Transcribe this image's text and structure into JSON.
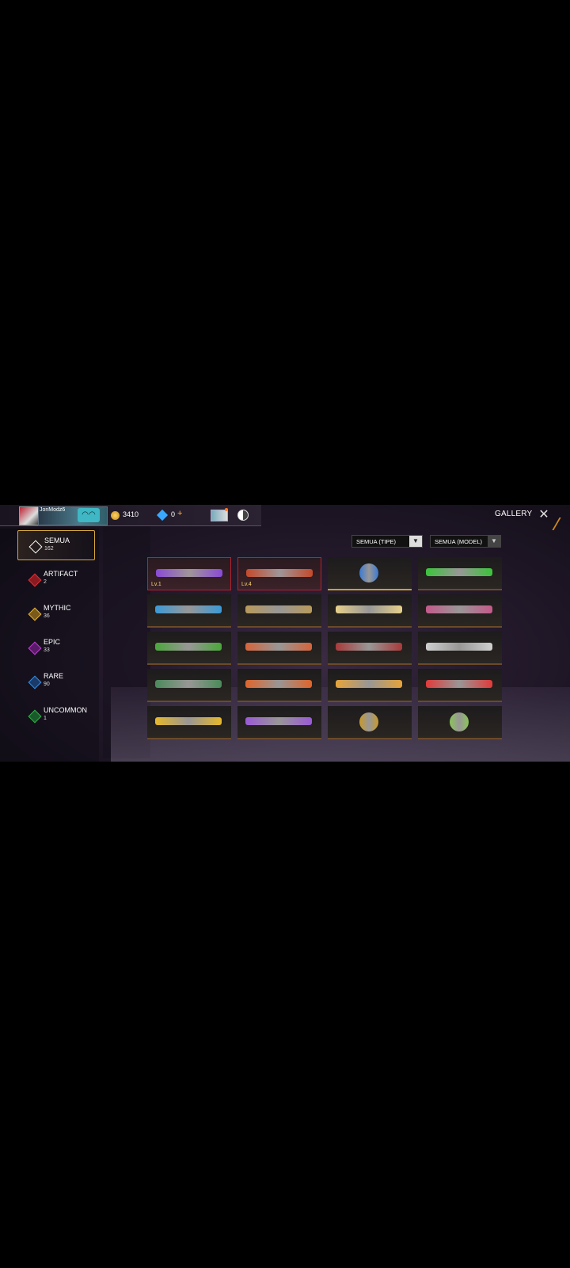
{
  "header": {
    "nickname": "JonModz6",
    "coins": "3410",
    "diamonds": "0",
    "diamond_plus": "+",
    "title": "GALLERY",
    "close": "✕"
  },
  "sidebar": {
    "items": [
      {
        "label": "SEMUA",
        "count": "162",
        "color": "#ffffff",
        "active": true
      },
      {
        "label": "ARTIFACT",
        "count": "2",
        "color": "#e0303a"
      },
      {
        "label": "MYTHIC",
        "count": "36",
        "color": "#e3b43a"
      },
      {
        "label": "EPIC",
        "count": "33",
        "color": "#c23fd6"
      },
      {
        "label": "RARE",
        "count": "90",
        "color": "#3a8fe0"
      },
      {
        "label": "UNCOMMON",
        "count": "1",
        "color": "#32b24a"
      }
    ]
  },
  "filters": {
    "type": "SEMUA (TIPE)",
    "model": "SEMUA (MODEL)",
    "arrow": "▼"
  },
  "grid": {
    "items": [
      {
        "icon": "purple-rifle-icon",
        "level": "Lv.1",
        "color": "#8a4ad6"
      },
      {
        "icon": "dragon-rifle-icon",
        "level": "Lv.4",
        "color": "#c44a2a"
      },
      {
        "icon": "blue-mask-icon",
        "color": "#3a7ad6"
      },
      {
        "icon": "green-rifle-icon",
        "color": "#3ac43a"
      },
      {
        "icon": "blue-rifle-icon",
        "color": "#3a9ad6"
      },
      {
        "icon": "gold-rifle-icon",
        "color": "#b89a5a"
      },
      {
        "icon": "gold-white-rifle-icon",
        "color": "#e6d08a"
      },
      {
        "icon": "pink-smg-icon",
        "color": "#c45a8a"
      },
      {
        "icon": "green-dragon-gun-icon",
        "color": "#4aa63a"
      },
      {
        "icon": "fire-dragon-gun-icon",
        "color": "#d6643a"
      },
      {
        "icon": "red-rifle-icon",
        "color": "#a83a3a"
      },
      {
        "icon": "silver-rifle-icon",
        "color": "#cfcfcf"
      },
      {
        "icon": "green-shotgun-icon",
        "color": "#4a8a5a"
      },
      {
        "icon": "fire-crossbow-icon",
        "color": "#e0642a"
      },
      {
        "icon": "flame-dragon-icon",
        "color": "#e6a33a"
      },
      {
        "icon": "candy-cane-icon",
        "color": "#e03a3a"
      },
      {
        "icon": "yellow-umbrella-icon",
        "color": "#e6b82a"
      },
      {
        "icon": "purple-scythe-icon",
        "color": "#9a5ad6"
      },
      {
        "icon": "gold-grenade-icon",
        "color": "#c89a2a"
      },
      {
        "icon": "green-grenade-icon",
        "color": "#8ac45a"
      }
    ]
  }
}
